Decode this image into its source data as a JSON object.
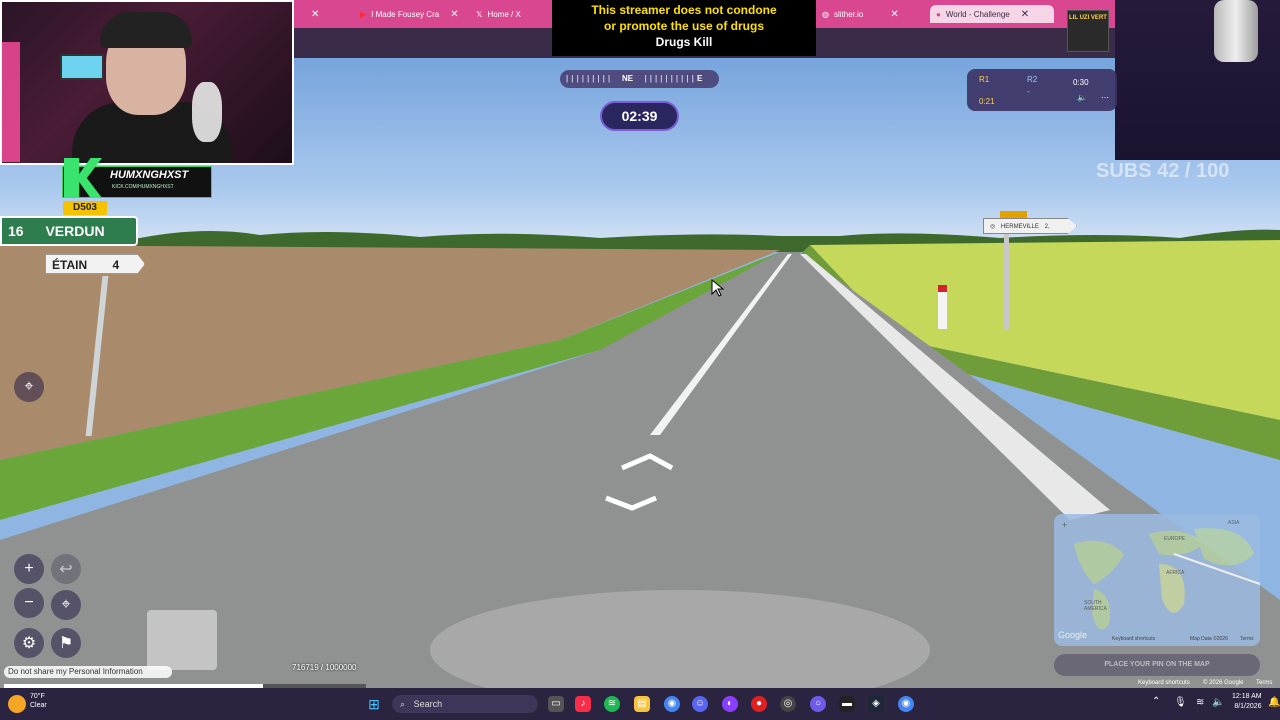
{
  "browser": {
    "tabs": [
      {
        "label": "",
        "favicon": "tab-favicon"
      },
      {
        "label": "I Made Fousey Cra",
        "favicon": "youtube-icon"
      },
      {
        "label": "Home / X",
        "favicon": "x-icon"
      },
      {
        "label": "slither.io",
        "favicon": "globe-icon"
      },
      {
        "label": "World - Challenge",
        "favicon": "map-pin-icon"
      }
    ]
  },
  "banner": {
    "line1": "This streamer does not condone",
    "line2": "or promote the use of drugs",
    "line3": "Drugs Kill"
  },
  "stream": {
    "channel_name": "HUMXNGHXST",
    "channel_sub": "KICK.COM/HUMXNGHXST",
    "subs_goal": "SUBS 42 / 100"
  },
  "media_player": {
    "album_label": "LIL UZI VERT",
    "elapsed": "0:30"
  },
  "game": {
    "compass": {
      "ne": "NE",
      "e": "E"
    },
    "timer": "02:39",
    "rounds": {
      "r1_label": "R1",
      "r1_time": "0:21",
      "r2_label": "R2",
      "r2_score": "-"
    },
    "progress_text": "716719 / 1000000",
    "progress_fraction": 0.716719,
    "guess_button": "PLACE YOUR PIN ON THE MAP",
    "privacy_text": "Do not share my Personal Information",
    "minimap_labels": [
      "EUROPE",
      "AFRICA",
      "SOUTH AMERICA",
      "ASIA"
    ],
    "google_footer": [
      "Keyboard shortcuts",
      "Map Data ©2026",
      "Terms"
    ],
    "google_logo": "Google",
    "scene_footer": [
      "Keyboard shortcuts",
      "© 2026 Google",
      "Terms"
    ]
  },
  "road_signs": {
    "route_number": "D503",
    "verdun_distance": "16",
    "verdun_name": "VERDUN",
    "etain_name": "ÉTAIN",
    "etain_distance": "4",
    "hermeville": "HERMEVILLE",
    "hermeville_distance": "2,"
  },
  "taskbar": {
    "weather_temp": "70°F",
    "weather_desc": "Clear",
    "search_placeholder": "Search",
    "time": "12:18 AM",
    "date": "8/1/2026"
  },
  "colors": {
    "tabbar": "#d8478f",
    "banner_text": "#ffe100",
    "timer_border": "#7b5cd6",
    "taskbar": "#2a2440"
  }
}
